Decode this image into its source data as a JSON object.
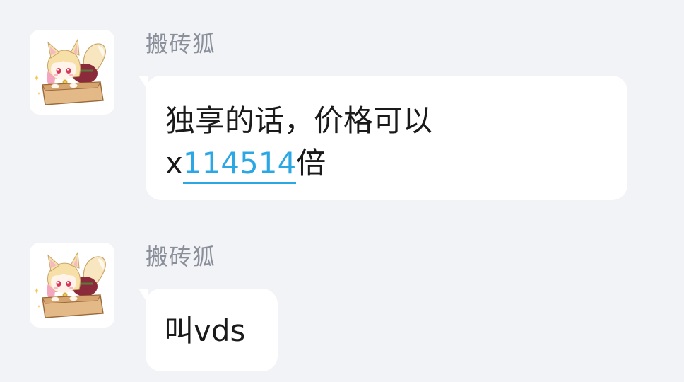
{
  "messages": [
    {
      "sender": "搬砖狐",
      "avatar_icon": "fox-girl-in-box-avatar",
      "line1": "独享的话，价格可以",
      "line2_prefix": "x",
      "line2_link": "114514",
      "line2_suffix": "倍"
    },
    {
      "sender": "搬砖狐",
      "avatar_icon": "fox-girl-in-box-avatar",
      "text": "叫vds"
    }
  ],
  "colors": {
    "background": "#f2f3f7",
    "bubble": "#ffffff",
    "sender": "#8a8f9a",
    "link": "#2aa7e4",
    "text": "#1a1a1a"
  }
}
